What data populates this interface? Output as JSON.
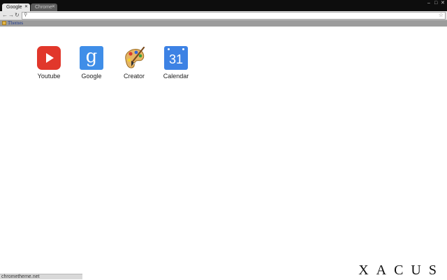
{
  "tabs": [
    {
      "label": "Google",
      "active": true
    },
    {
      "label": "Chrome",
      "active": false
    }
  ],
  "toolbar": {
    "back_icon": "back-arrow-icon",
    "forward_icon": "forward-arrow-icon",
    "reload_icon": "reload-icon",
    "url": "",
    "search_icon": "search-icon",
    "star_icon": "star-icon"
  },
  "bookmarks": [
    {
      "label": "Themes",
      "icon": "folder-icon"
    }
  ],
  "shortcuts": [
    {
      "label": "Youtube",
      "icon": "youtube-icon"
    },
    {
      "label": "Google",
      "icon": "google-icon",
      "glyph": "g"
    },
    {
      "label": "Creator",
      "icon": "palette-icon"
    },
    {
      "label": "Calendar",
      "icon": "calendar-icon",
      "glyph": "31"
    }
  ],
  "status_bar": {
    "text": "chrometheme.net"
  },
  "branding": {
    "text": "XACUS"
  },
  "colors": {
    "frame": "#0d0d0d",
    "toolbar": "#e6e6e6",
    "bookmarks_bar": "#9c9c9c",
    "page_bg": "#ffffff"
  }
}
